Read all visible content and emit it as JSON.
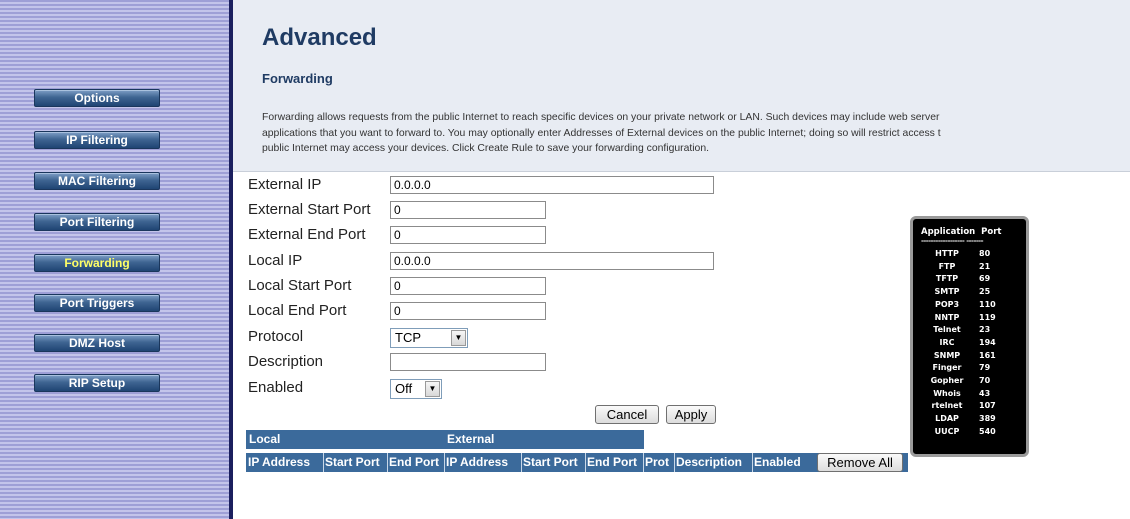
{
  "sidebar": {
    "items": [
      {
        "label": "Options"
      },
      {
        "label": "IP Filtering"
      },
      {
        "label": "MAC Filtering"
      },
      {
        "label": "Port Filtering"
      },
      {
        "label": "Forwarding",
        "active": true
      },
      {
        "label": "Port Triggers"
      },
      {
        "label": "DMZ Host"
      },
      {
        "label": "RIP Setup"
      }
    ]
  },
  "header": {
    "title": "Advanced",
    "section": "Forwarding",
    "intro_lines": [
      "Forwarding allows requests from the public Internet to reach specific devices on your private network or LAN. Such devices may include web server",
      "applications that you want to forward to. You may optionally enter Addresses of External devices on the public Internet; doing so will restrict access t",
      "public Internet may access your devices. Click Create Rule to save your forwarding configuration."
    ]
  },
  "form": {
    "external_ip": {
      "label": "External IP",
      "value": "0.0.0.0"
    },
    "external_start_port": {
      "label": "External Start Port",
      "value": "0"
    },
    "external_end_port": {
      "label": "External End Port",
      "value": "0"
    },
    "local_ip": {
      "label": "Local IP",
      "value": "0.0.0.0"
    },
    "local_start_port": {
      "label": "Local Start Port",
      "value": "0"
    },
    "local_end_port": {
      "label": "Local End Port",
      "value": "0"
    },
    "protocol": {
      "label": "Protocol",
      "value": "TCP"
    },
    "description": {
      "label": "Description",
      "value": ""
    },
    "enabled": {
      "label": "Enabled",
      "value": "Off"
    },
    "cancel_label": "Cancel",
    "apply_label": "Apply"
  },
  "table": {
    "group_headers": {
      "local": "Local",
      "external": "External"
    },
    "columns": [
      "IP Address",
      "Start Port",
      "End Port",
      "IP Address",
      "Start Port",
      "End Port",
      "Prot",
      "Description",
      "Enabled"
    ],
    "remove_all_label": "Remove All"
  },
  "port_list": {
    "header_app": "Application",
    "header_port": "Port",
    "dashes": "------------------   -------",
    "rows": [
      {
        "app": "HTTP",
        "port": "80"
      },
      {
        "app": "FTP",
        "port": "21"
      },
      {
        "app": "TFTP",
        "port": "69"
      },
      {
        "app": "SMTP",
        "port": "25"
      },
      {
        "app": "POP3",
        "port": "110"
      },
      {
        "app": "NNTP",
        "port": "119"
      },
      {
        "app": "Telnet",
        "port": "23"
      },
      {
        "app": "IRC",
        "port": "194"
      },
      {
        "app": "SNMP",
        "port": "161"
      },
      {
        "app": "Finger",
        "port": "79"
      },
      {
        "app": "Gopher",
        "port": "70"
      },
      {
        "app": "Whois",
        "port": "43"
      },
      {
        "app": "rtelnet",
        "port": "107"
      },
      {
        "app": "LDAP",
        "port": "389"
      },
      {
        "app": "UUCP",
        "port": "540"
      }
    ]
  },
  "colors": {
    "sidebar_stripe_dark": "#9e9fd6",
    "sidebar_stripe_light": "#c3c4ea",
    "nav_button": "#3f6592",
    "active_label": "#ffff66",
    "title_color": "#1f3b63",
    "table_header": "#3b6a9b"
  }
}
